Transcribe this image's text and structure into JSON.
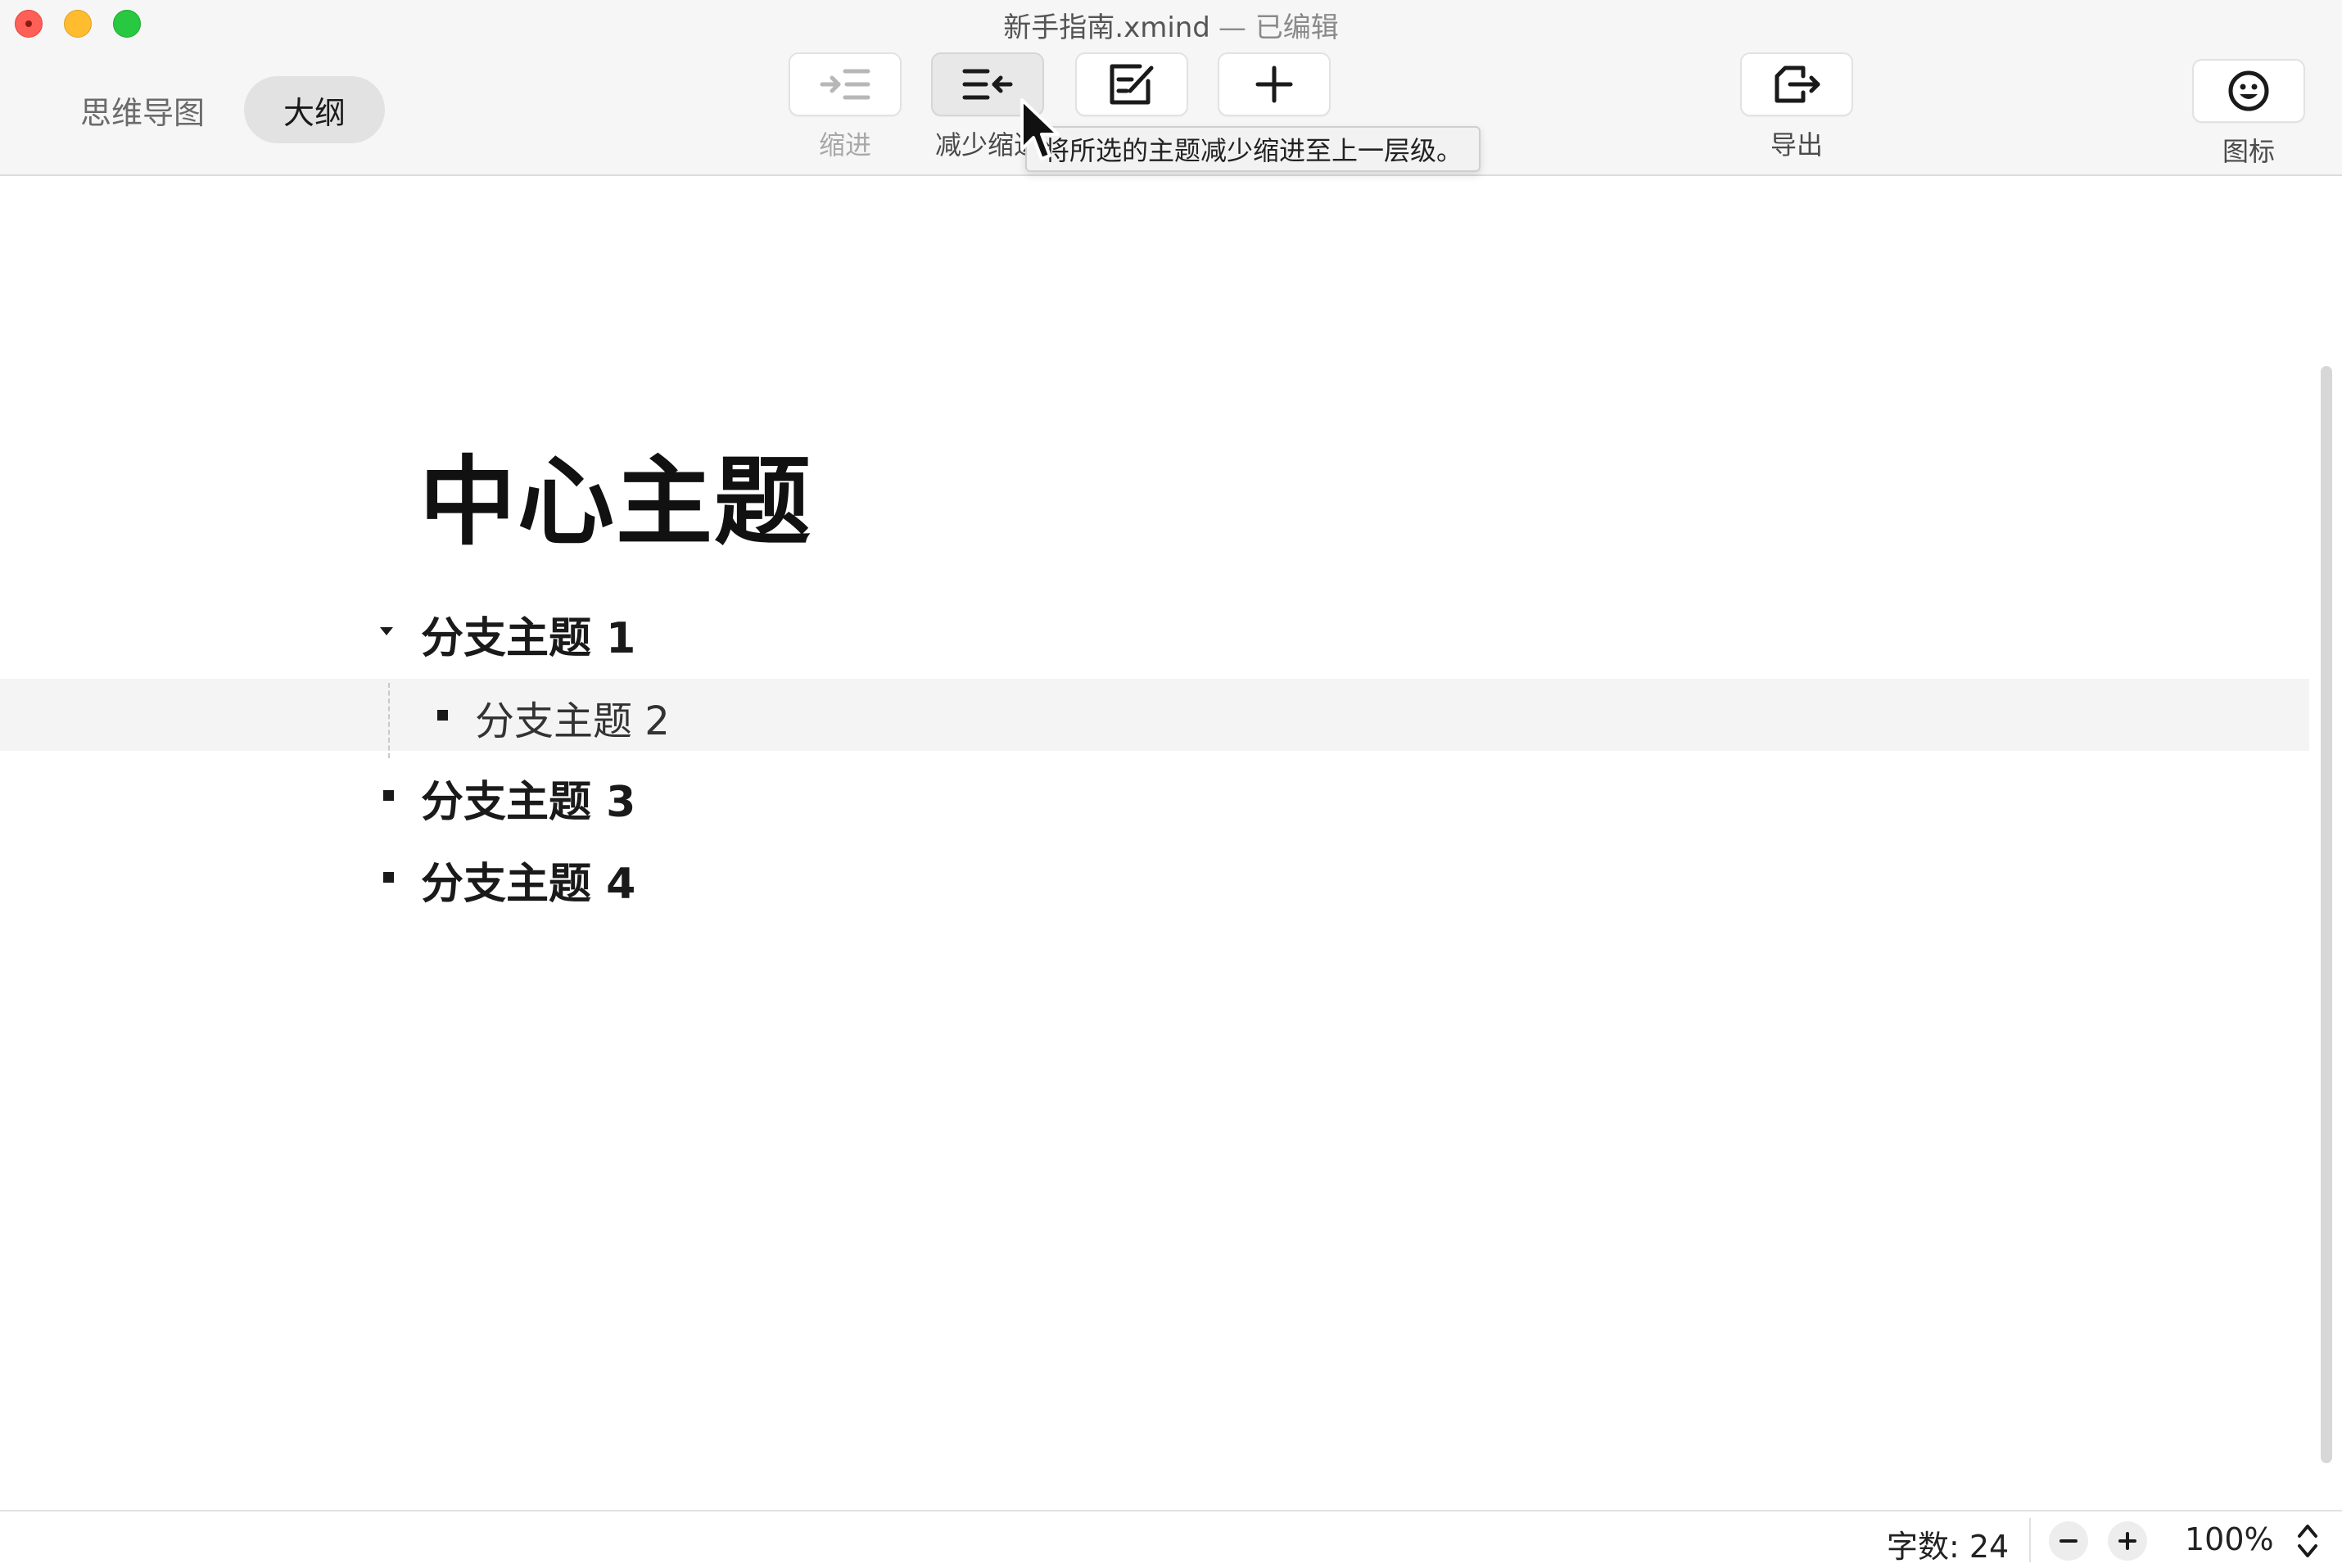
{
  "window": {
    "title": "新手指南.xmind",
    "status": "— 已编辑"
  },
  "view_switch": {
    "tabs": [
      {
        "label": "思维导图",
        "active": false
      },
      {
        "label": "大纲",
        "active": true
      }
    ]
  },
  "toolbar": {
    "indent": {
      "label": "缩进",
      "icon": "indent-icon",
      "enabled": false
    },
    "outdent": {
      "label": "减少缩进",
      "icon": "outdent-icon",
      "pressed": true
    },
    "note": {
      "label": "",
      "icon": "edit-note-icon"
    },
    "add": {
      "label": "",
      "icon": "plus-icon"
    },
    "export": {
      "label": "导出",
      "icon": "export-icon"
    },
    "icon_panel": {
      "label": "图标",
      "icon": "smiley-icon"
    }
  },
  "tooltip": {
    "text": "将所选的主题减少缩进至上一层级。"
  },
  "outline": {
    "central_topic": "中心主题",
    "topics": [
      {
        "label": "分支主题 1",
        "level": 1,
        "collapsed": false
      },
      {
        "label": "分支主题 2",
        "level": 2,
        "selected": true
      },
      {
        "label": "分支主题 3",
        "level": 1
      },
      {
        "label": "分支主题 4",
        "level": 1
      }
    ]
  },
  "status_bar": {
    "word_count": "字数: 24",
    "zoom_level": "100%"
  },
  "colors": {
    "close": "#fe5f57",
    "minimize": "#febc2e",
    "zoom": "#28c840",
    "active_tab_bg": "#e2e2e2",
    "selected_row_bg": "#f4f4f4"
  }
}
